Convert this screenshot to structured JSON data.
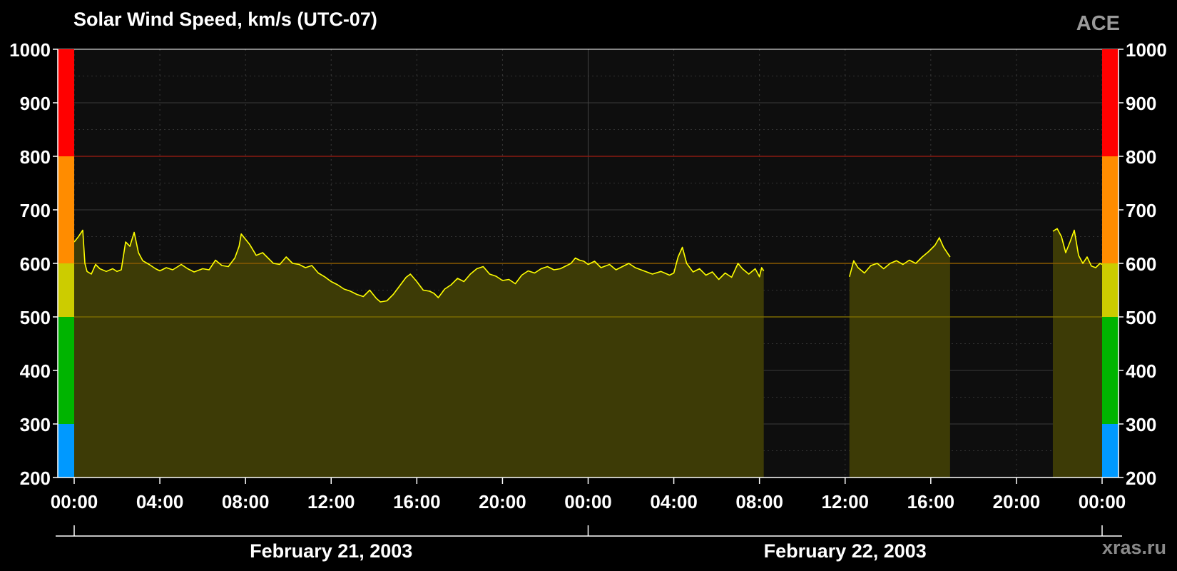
{
  "header": {
    "title": "Solar Wind Speed, km/s (UTC-07)",
    "source": "ACE",
    "credit": "xras.ru"
  },
  "chart_data": {
    "type": "area",
    "title": "Solar Wind Speed, km/s (UTC-07)",
    "xlabel": "",
    "ylabel": "",
    "ylim": [
      200,
      1000
    ],
    "yticks": [
      200,
      300,
      400,
      500,
      600,
      700,
      800,
      900,
      1000
    ],
    "ytick_labels": [
      "200",
      "300",
      "400",
      "500",
      "600",
      "700",
      "800",
      "900",
      "1000"
    ],
    "xlim_hours": [
      0,
      48
    ],
    "xticks_hours": [
      0,
      4,
      8,
      12,
      16,
      20,
      24,
      28,
      32,
      36,
      40,
      44,
      48
    ],
    "xtick_labels": [
      "00:00",
      "04:00",
      "08:00",
      "12:00",
      "16:00",
      "20:00",
      "00:00",
      "04:00",
      "08:00",
      "12:00",
      "16:00",
      "20:00",
      "00:00"
    ],
    "date_labels": [
      {
        "label": "February 21, 2003",
        "center_hour": 12
      },
      {
        "label": "February 22, 2003",
        "center_hour": 36
      }
    ],
    "grid": true,
    "line_color": "#ffff00",
    "fill_color": "#3d3b06",
    "threshold_lines": [
      {
        "value": 500,
        "color": "#7a6a00"
      },
      {
        "value": 600,
        "color": "#8a5a00"
      },
      {
        "value": 800,
        "color": "#8a1a10"
      }
    ],
    "scale_bands": [
      {
        "from": 200,
        "to": 300,
        "color": "#0099ff"
      },
      {
        "from": 300,
        "to": 500,
        "color": "#00b400"
      },
      {
        "from": 500,
        "to": 600,
        "color": "#cccc00"
      },
      {
        "from": 600,
        "to": 800,
        "color": "#ff8c00"
      },
      {
        "from": 800,
        "to": 1000,
        "color": "#ff0000"
      }
    ],
    "series": [
      {
        "name": "",
        "points": [
          [
            0.0,
            640
          ],
          [
            0.2,
            650
          ],
          [
            0.4,
            662
          ],
          [
            0.5,
            600
          ],
          [
            0.6,
            585
          ],
          [
            0.8,
            580
          ],
          [
            1.0,
            598
          ],
          [
            1.2,
            590
          ],
          [
            1.5,
            585
          ],
          [
            1.8,
            590
          ],
          [
            2.0,
            585
          ],
          [
            2.2,
            588
          ],
          [
            2.4,
            640
          ],
          [
            2.6,
            632
          ],
          [
            2.8,
            658
          ],
          [
            3.0,
            620
          ],
          [
            3.2,
            605
          ],
          [
            3.5,
            598
          ],
          [
            3.8,
            590
          ],
          [
            4.0,
            586
          ],
          [
            4.3,
            592
          ],
          [
            4.6,
            588
          ],
          [
            5.0,
            598
          ],
          [
            5.3,
            590
          ],
          [
            5.6,
            584
          ],
          [
            6.0,
            590
          ],
          [
            6.3,
            588
          ],
          [
            6.6,
            606
          ],
          [
            6.9,
            596
          ],
          [
            7.2,
            594
          ],
          [
            7.5,
            610
          ],
          [
            7.7,
            632
          ],
          [
            7.8,
            655
          ],
          [
            8.0,
            645
          ],
          [
            8.2,
            635
          ],
          [
            8.5,
            615
          ],
          [
            8.8,
            620
          ],
          [
            9.0,
            612
          ],
          [
            9.3,
            600
          ],
          [
            9.6,
            598
          ],
          [
            9.9,
            612
          ],
          [
            10.2,
            600
          ],
          [
            10.5,
            598
          ],
          [
            10.8,
            592
          ],
          [
            11.1,
            596
          ],
          [
            11.4,
            582
          ],
          [
            11.7,
            575
          ],
          [
            12.0,
            566
          ],
          [
            12.3,
            560
          ],
          [
            12.6,
            552
          ],
          [
            12.9,
            548
          ],
          [
            13.2,
            542
          ],
          [
            13.5,
            538
          ],
          [
            13.8,
            550
          ],
          [
            14.1,
            535
          ],
          [
            14.3,
            528
          ],
          [
            14.6,
            530
          ],
          [
            14.9,
            542
          ],
          [
            15.2,
            558
          ],
          [
            15.5,
            574
          ],
          [
            15.7,
            580
          ],
          [
            16.0,
            566
          ],
          [
            16.3,
            550
          ],
          [
            16.6,
            548
          ],
          [
            16.8,
            544
          ],
          [
            17.0,
            536
          ],
          [
            17.3,
            552
          ],
          [
            17.6,
            560
          ],
          [
            17.9,
            572
          ],
          [
            18.2,
            566
          ],
          [
            18.5,
            580
          ],
          [
            18.8,
            590
          ],
          [
            19.1,
            594
          ],
          [
            19.4,
            580
          ],
          [
            19.7,
            576
          ],
          [
            20.0,
            568
          ],
          [
            20.3,
            570
          ],
          [
            20.6,
            562
          ],
          [
            20.9,
            578
          ],
          [
            21.2,
            586
          ],
          [
            21.5,
            582
          ],
          [
            21.8,
            590
          ],
          [
            22.1,
            594
          ],
          [
            22.4,
            588
          ],
          [
            22.7,
            590
          ],
          [
            23.0,
            596
          ],
          [
            23.2,
            600
          ],
          [
            23.4,
            610
          ],
          [
            23.6,
            606
          ],
          [
            23.8,
            604
          ],
          [
            24.0,
            598
          ],
          [
            24.3,
            604
          ],
          [
            24.6,
            592
          ],
          [
            25.0,
            598
          ],
          [
            25.3,
            588
          ],
          [
            25.6,
            594
          ],
          [
            25.9,
            600
          ],
          [
            26.2,
            592
          ],
          [
            26.6,
            586
          ],
          [
            27.0,
            580
          ],
          [
            27.4,
            585
          ],
          [
            27.8,
            578
          ],
          [
            28.0,
            582
          ],
          [
            28.2,
            612
          ],
          [
            28.4,
            630
          ],
          [
            28.6,
            600
          ],
          [
            28.9,
            584
          ],
          [
            29.2,
            590
          ],
          [
            29.5,
            578
          ],
          [
            29.8,
            584
          ],
          [
            30.1,
            570
          ],
          [
            30.4,
            582
          ],
          [
            30.7,
            574
          ],
          [
            31.0,
            600
          ],
          [
            31.2,
            590
          ],
          [
            31.5,
            580
          ],
          [
            31.8,
            590
          ],
          [
            32.0,
            575
          ],
          [
            32.1,
            592
          ],
          [
            32.2,
            586
          ],
          [
            null,
            null
          ],
          [
            36.2,
            575
          ],
          [
            36.4,
            605
          ],
          [
            36.6,
            592
          ],
          [
            36.9,
            582
          ],
          [
            37.2,
            596
          ],
          [
            37.5,
            600
          ],
          [
            37.8,
            590
          ],
          [
            38.1,
            600
          ],
          [
            38.4,
            605
          ],
          [
            38.7,
            598
          ],
          [
            39.0,
            606
          ],
          [
            39.3,
            600
          ],
          [
            39.6,
            612
          ],
          [
            39.9,
            622
          ],
          [
            40.2,
            634
          ],
          [
            40.4,
            648
          ],
          [
            40.6,
            630
          ],
          [
            40.8,
            618
          ],
          [
            40.9,
            612
          ],
          [
            null,
            null
          ],
          [
            45.7,
            660
          ],
          [
            45.9,
            665
          ],
          [
            46.1,
            650
          ],
          [
            46.3,
            620
          ],
          [
            46.5,
            640
          ],
          [
            46.7,
            662
          ],
          [
            46.9,
            615
          ],
          [
            47.1,
            600
          ],
          [
            47.3,
            612
          ],
          [
            47.5,
            595
          ],
          [
            47.7,
            592
          ],
          [
            47.9,
            600
          ],
          [
            48.0,
            598
          ]
        ]
      }
    ]
  }
}
